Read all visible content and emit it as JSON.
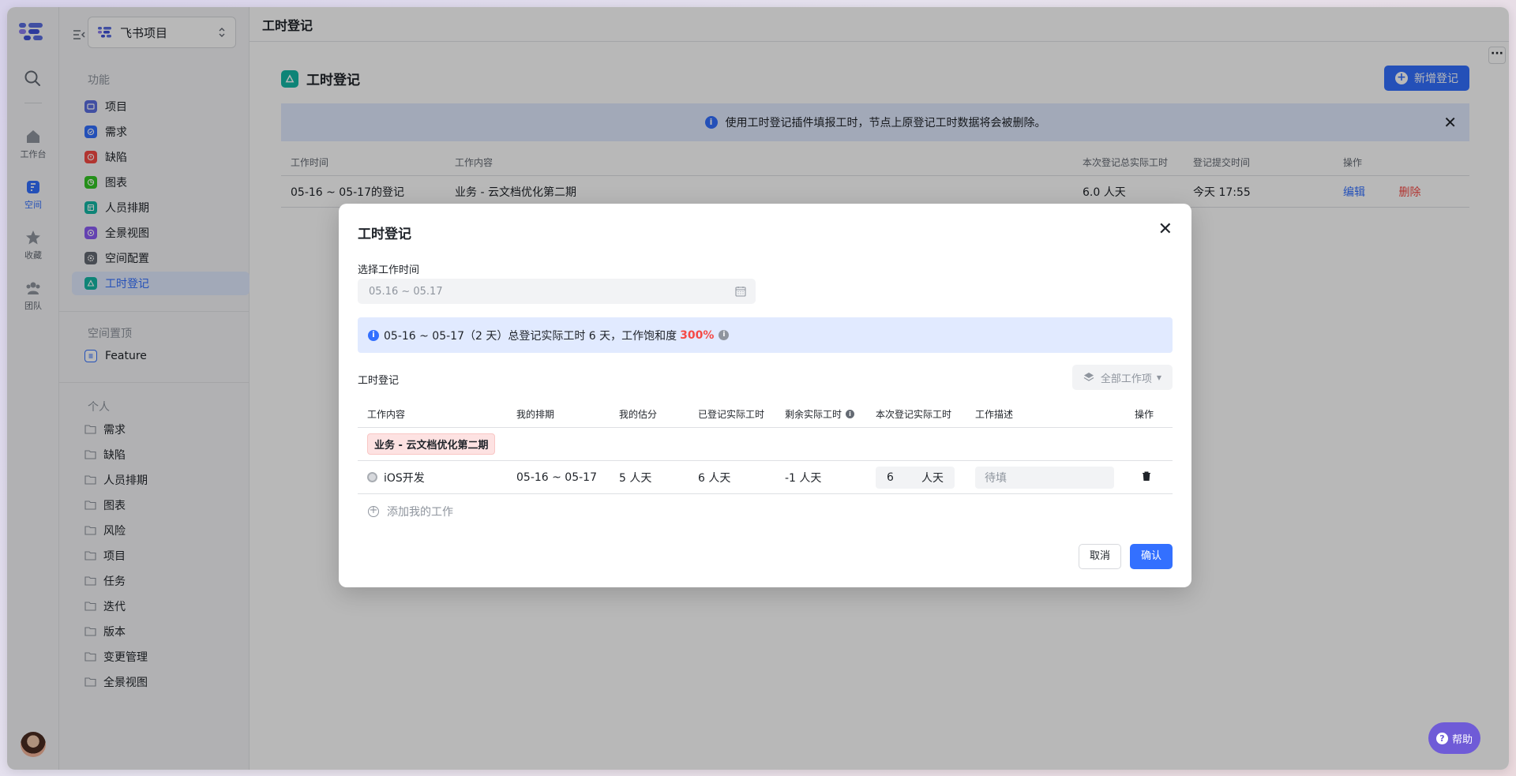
{
  "rail": {
    "items": [
      {
        "label": "工作台",
        "icon": "home-icon"
      },
      {
        "label": "空间",
        "icon": "space-icon",
        "active": true
      },
      {
        "label": "收藏",
        "icon": "star-icon"
      },
      {
        "label": "团队",
        "icon": "team-icon"
      }
    ]
  },
  "sidebar": {
    "project": "飞书项目",
    "section_features": "功能",
    "features": [
      {
        "label": "项目",
        "color": "#5b6ee1"
      },
      {
        "label": "需求",
        "color": "#3370ff"
      },
      {
        "label": "缺陷",
        "color": "#f54a45"
      },
      {
        "label": "图表",
        "color": "#34c724"
      },
      {
        "label": "人员排期",
        "color": "#14b8a6"
      },
      {
        "label": "全景视图",
        "color": "#8b5cf6"
      },
      {
        "label": "空间配置",
        "color": "#646a73"
      },
      {
        "label": "工时登记",
        "color": "#14b8a6",
        "active": true
      }
    ],
    "section_pinned": "空间置顶",
    "pinned": [
      {
        "label": "Feature"
      }
    ],
    "section_personal": "个人",
    "personal": [
      "需求",
      "缺陷",
      "人员排期",
      "图表",
      "风险",
      "项目",
      "任务",
      "迭代",
      "版本",
      "变更管理",
      "全景视图"
    ]
  },
  "main": {
    "topbar_title": "工时登记",
    "page_title": "工时登记",
    "new_button": "新增登记",
    "banner": "使用工时登记插件填报工时，节点上原登记工时数据将会被删除。",
    "table": {
      "headers": [
        "工作时间",
        "工作内容",
        "本次登记总实际工时",
        "登记提交时间",
        "操作"
      ],
      "rows": [
        {
          "time": "05-16 ~ 05-17的登记",
          "content": "业务 - 云文档优化第二期",
          "total": "6.0 人天",
          "submitted": "今天 17:55",
          "edit": "编辑",
          "delete": "删除"
        }
      ]
    }
  },
  "modal": {
    "title": "工时登记",
    "date_label": "选择工作时间",
    "date_value": "05.16 ~ 05.17",
    "summary_text": "05-16 ~ 05-17（2 天）总登记实际工时 6 天，工作饱和度",
    "summary_pct": "300%",
    "sub_title": "工时登记",
    "filter": "全部工作项",
    "headers": [
      "工作内容",
      "我的排期",
      "我的估分",
      "已登记实际工时",
      "剩余实际工时",
      "本次登记实际工时",
      "工作描述",
      "操作"
    ],
    "group_tag": "业务 - 云文档优化第二期",
    "row": {
      "name": "iOS开发",
      "schedule": "05-16 ~ 05-17",
      "estimate": "5 人天",
      "registered": "6 人天",
      "remaining": "-1 人天",
      "hours_value": "6",
      "hours_unit": "人天",
      "desc_placeholder": "待填"
    },
    "add_work": "添加我的工作",
    "cancel": "取消",
    "confirm": "确认"
  },
  "help": "帮助",
  "colors": {
    "accent": "#3370ff",
    "danger": "#f54a45",
    "help": "#6f5bd7"
  }
}
